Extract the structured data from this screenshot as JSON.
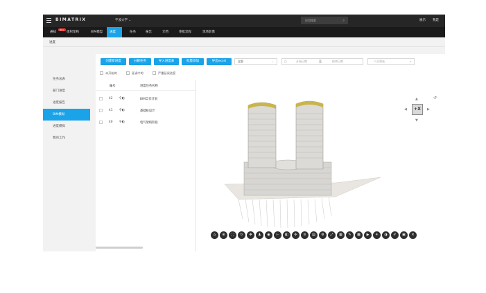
{
  "topbar": {
    "logo": "BIMATRIX",
    "project": "宁波大学 ⌄",
    "search_placeholder": "应用搜索",
    "search_icon": "search-icon",
    "right_items": [
      "展示",
      "我是"
    ]
  },
  "nav": {
    "badge": "99+",
    "items": [
      "通知",
      "组织架构",
      "BIM模型",
      "进度",
      "任务",
      "报告",
      "文档",
      "审批流程",
      "现场影像"
    ],
    "active_index": 3
  },
  "breadcrumb": "进度",
  "sidebar": {
    "items": [
      "任务总表",
      "部门进度",
      "进度报告",
      "BIM模拟",
      "进度模拟",
      "我的工作"
    ],
    "active_index": 3
  },
  "toolbar": {
    "buttons": [
      "创建新进度",
      "分解任务",
      "导入进度表",
      "批量添加",
      "导出excel"
    ],
    "filter_value": "全部",
    "start_date_placeholder": "开始日期",
    "date_sep": "至",
    "end_date_placeholder": "结束日期",
    "search_placeholder": "人员筛选"
  },
  "checks": [
    "未开始的",
    "延误中的",
    "严重延误进度"
  ],
  "table": {
    "headers": [
      "编号",
      "进度任务名称"
    ],
    "rows": [
      {
        "num": "42",
        "name": "BIM工作计划"
      },
      {
        "num": "41",
        "name": "基础桩设计"
      },
      {
        "num": "40",
        "name": "电气架构阶段"
      }
    ]
  },
  "viewer": {
    "cube_label": "+X",
    "tools": [
      "home-icon",
      "zoom-icon",
      "fit-icon",
      "orbit-icon",
      "pan-icon",
      "walk-icon",
      "camera-icon",
      "measure-icon",
      "section-icon",
      "explode-icon",
      "model-tree-icon",
      "properties-icon",
      "settings-icon",
      "fullscreen-icon",
      "layers-icon",
      "markup-icon",
      "grid-icon",
      "video-icon",
      "sun-icon",
      "palette-icon",
      "pen-icon",
      "screenshot-icon",
      "close-icon"
    ]
  },
  "colors": {
    "accent": "#1aa3e8",
    "topbar": "#262626",
    "navbar": "#1a1a1a"
  }
}
